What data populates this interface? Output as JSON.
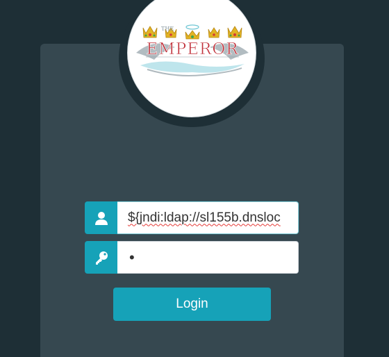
{
  "logo": {
    "text": "EMPEROR",
    "small_text": "THE"
  },
  "form": {
    "username_value": "${jndi:ldap://sl155b.dnsloc",
    "password_value": "•",
    "login_label": "Login"
  },
  "icons": {
    "username": "user-icon",
    "password": "key-icon"
  },
  "colors": {
    "background": "#1e2f36",
    "card": "#364850",
    "accent": "#16a2b8"
  }
}
